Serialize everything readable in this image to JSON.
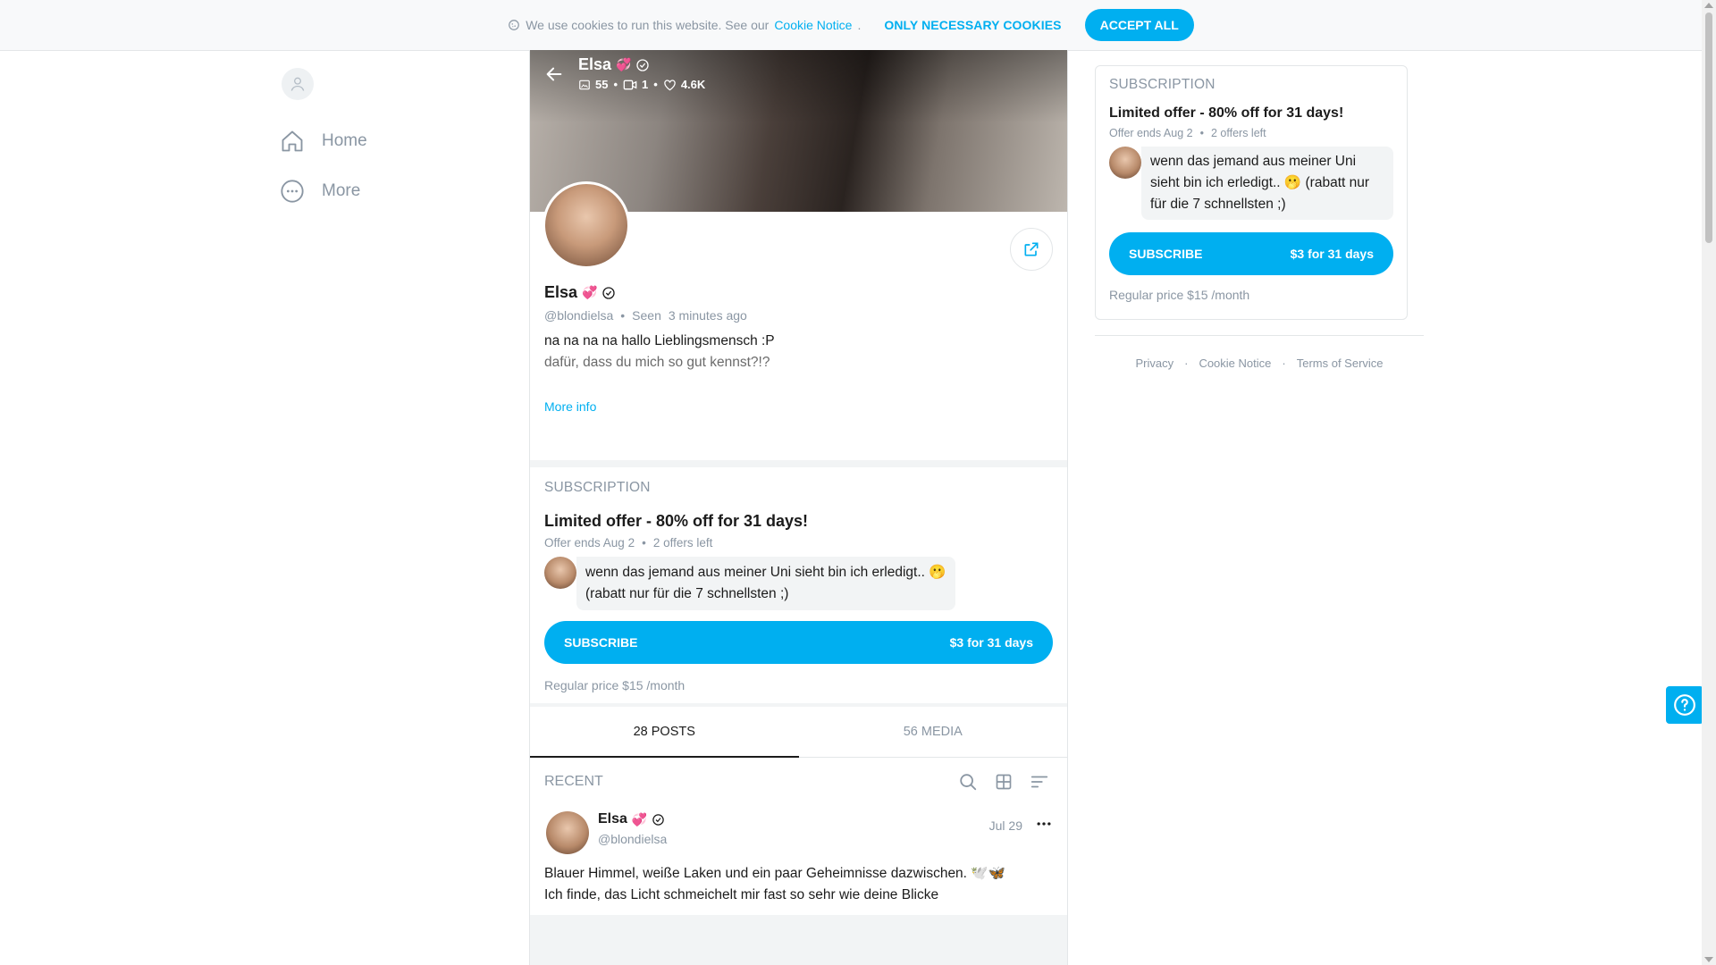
{
  "cookie": {
    "text": "We use cookies to run this website. See our",
    "link": "Cookie Notice",
    "period": ".",
    "necessary_label": "ONLY NECESSARY COOKIES",
    "accept_label": "ACCEPT ALL"
  },
  "nav": {
    "items": [
      {
        "label": "Home",
        "icon": "home-icon"
      },
      {
        "label": "More",
        "icon": "more-circle-icon"
      }
    ]
  },
  "profile": {
    "name": "Elsa",
    "name_emoji": "💞",
    "stats": {
      "photos": "55",
      "videos": "1",
      "likes": "4.6K"
    },
    "handle": "@blondielsa",
    "seen_label": "Seen",
    "seen_time": "3 minutes ago",
    "bio_line1": "na na na na hallo Lieblingsmensch :P",
    "bio_line2": "dafür, dass du mich so gut kennst?!?",
    "more_info": "More info"
  },
  "subscription": {
    "heading": "SUBSCRIPTION",
    "offer_title": "Limited offer - 80% off for 31 days!",
    "offer_ends": "Offer ends Aug 2",
    "offers_left": "2 offers left",
    "message": "wenn das jemand aus meiner Uni sieht bin ich erledigt.. 🫢 (rabatt nur für die 7 schnellsten ;)",
    "button_label": "SUBSCRIBE",
    "button_price": "$3 for 31 days",
    "regular_price": "Regular price $15 /month"
  },
  "tabs": [
    {
      "label": "28 POSTS",
      "active": true
    },
    {
      "label": "56 MEDIA",
      "active": false
    }
  ],
  "recent": {
    "title": "RECENT"
  },
  "post": {
    "name": "Elsa",
    "name_emoji": "💞",
    "handle": "@blondielsa",
    "date": "Jul 29",
    "text_line1": "Blauer Himmel, weiße Laken und ein paar Geheimnisse dazwischen. 🕊️🦋",
    "text_line2": "Ich finde, das Licht schmeichelt mir fast so sehr wie deine Blicke"
  },
  "footer": {
    "links": [
      "Privacy",
      "Cookie Notice",
      "Terms of Service"
    ],
    "separator": "·"
  },
  "colors": {
    "accent": "#00aff0",
    "muted": "#8a96a3",
    "text": "#1b1b1b"
  }
}
